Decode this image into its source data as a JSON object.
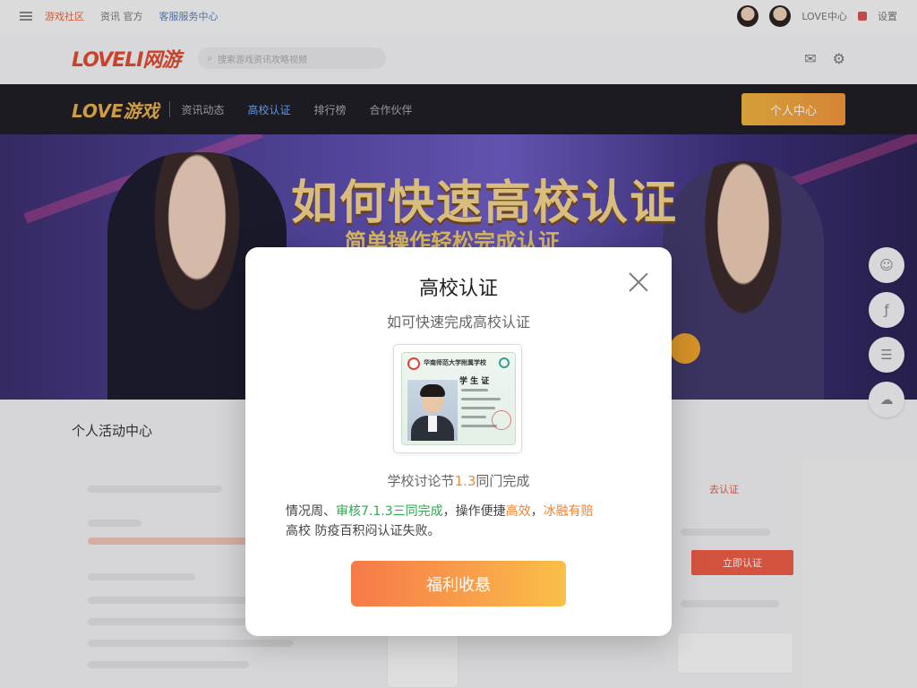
{
  "topbar": {
    "links": [
      "游戏社区",
      "资讯 官方",
      "客服服务中心"
    ],
    "right_text": "LOVE中心",
    "right_text2": "设置"
  },
  "header": {
    "logo": "LOVELI网游",
    "search_placeholder": "搜索游戏资讯攻略视频",
    "search_icon": "search-icon"
  },
  "nav": {
    "logo": "LOVE游戏",
    "items": [
      "资讯动态",
      "高校认证",
      "排行榜",
      "合作伙伴"
    ],
    "center_button": "个人中心"
  },
  "banner": {
    "headline": "如何快速高校认证",
    "subline": "简单操作轻松完成认证"
  },
  "content": {
    "title": "个人活动中心",
    "red_link": "去认证",
    "red_button": "立即认证"
  },
  "modal": {
    "title": "高校认证",
    "subtitle": "如可快速完成高校认证",
    "card": {
      "school": "华南师范大学附属学校",
      "card_title": "学 生 证"
    },
    "line1_prefix": "学校讨论节",
    "line1_highlight": "1.3",
    "line1_suffix": "同门完成",
    "desc": {
      "p1": "情况周、",
      "g1": "审核7.1.3三同完成",
      "p2": "，操作便捷",
      "o1": "高效",
      "p3": "，",
      "o2": "冰融有赔",
      "p4": "高校 防疫百积闷认证失败。"
    },
    "cta_label": "福利收悬"
  },
  "colors": {
    "cta_gradient_start": "#f67a48",
    "cta_gradient_end": "#fac048",
    "green_highlight": "#2eaa4e",
    "orange_highlight": "#f0822e",
    "nav_button": "#f0b33e"
  }
}
